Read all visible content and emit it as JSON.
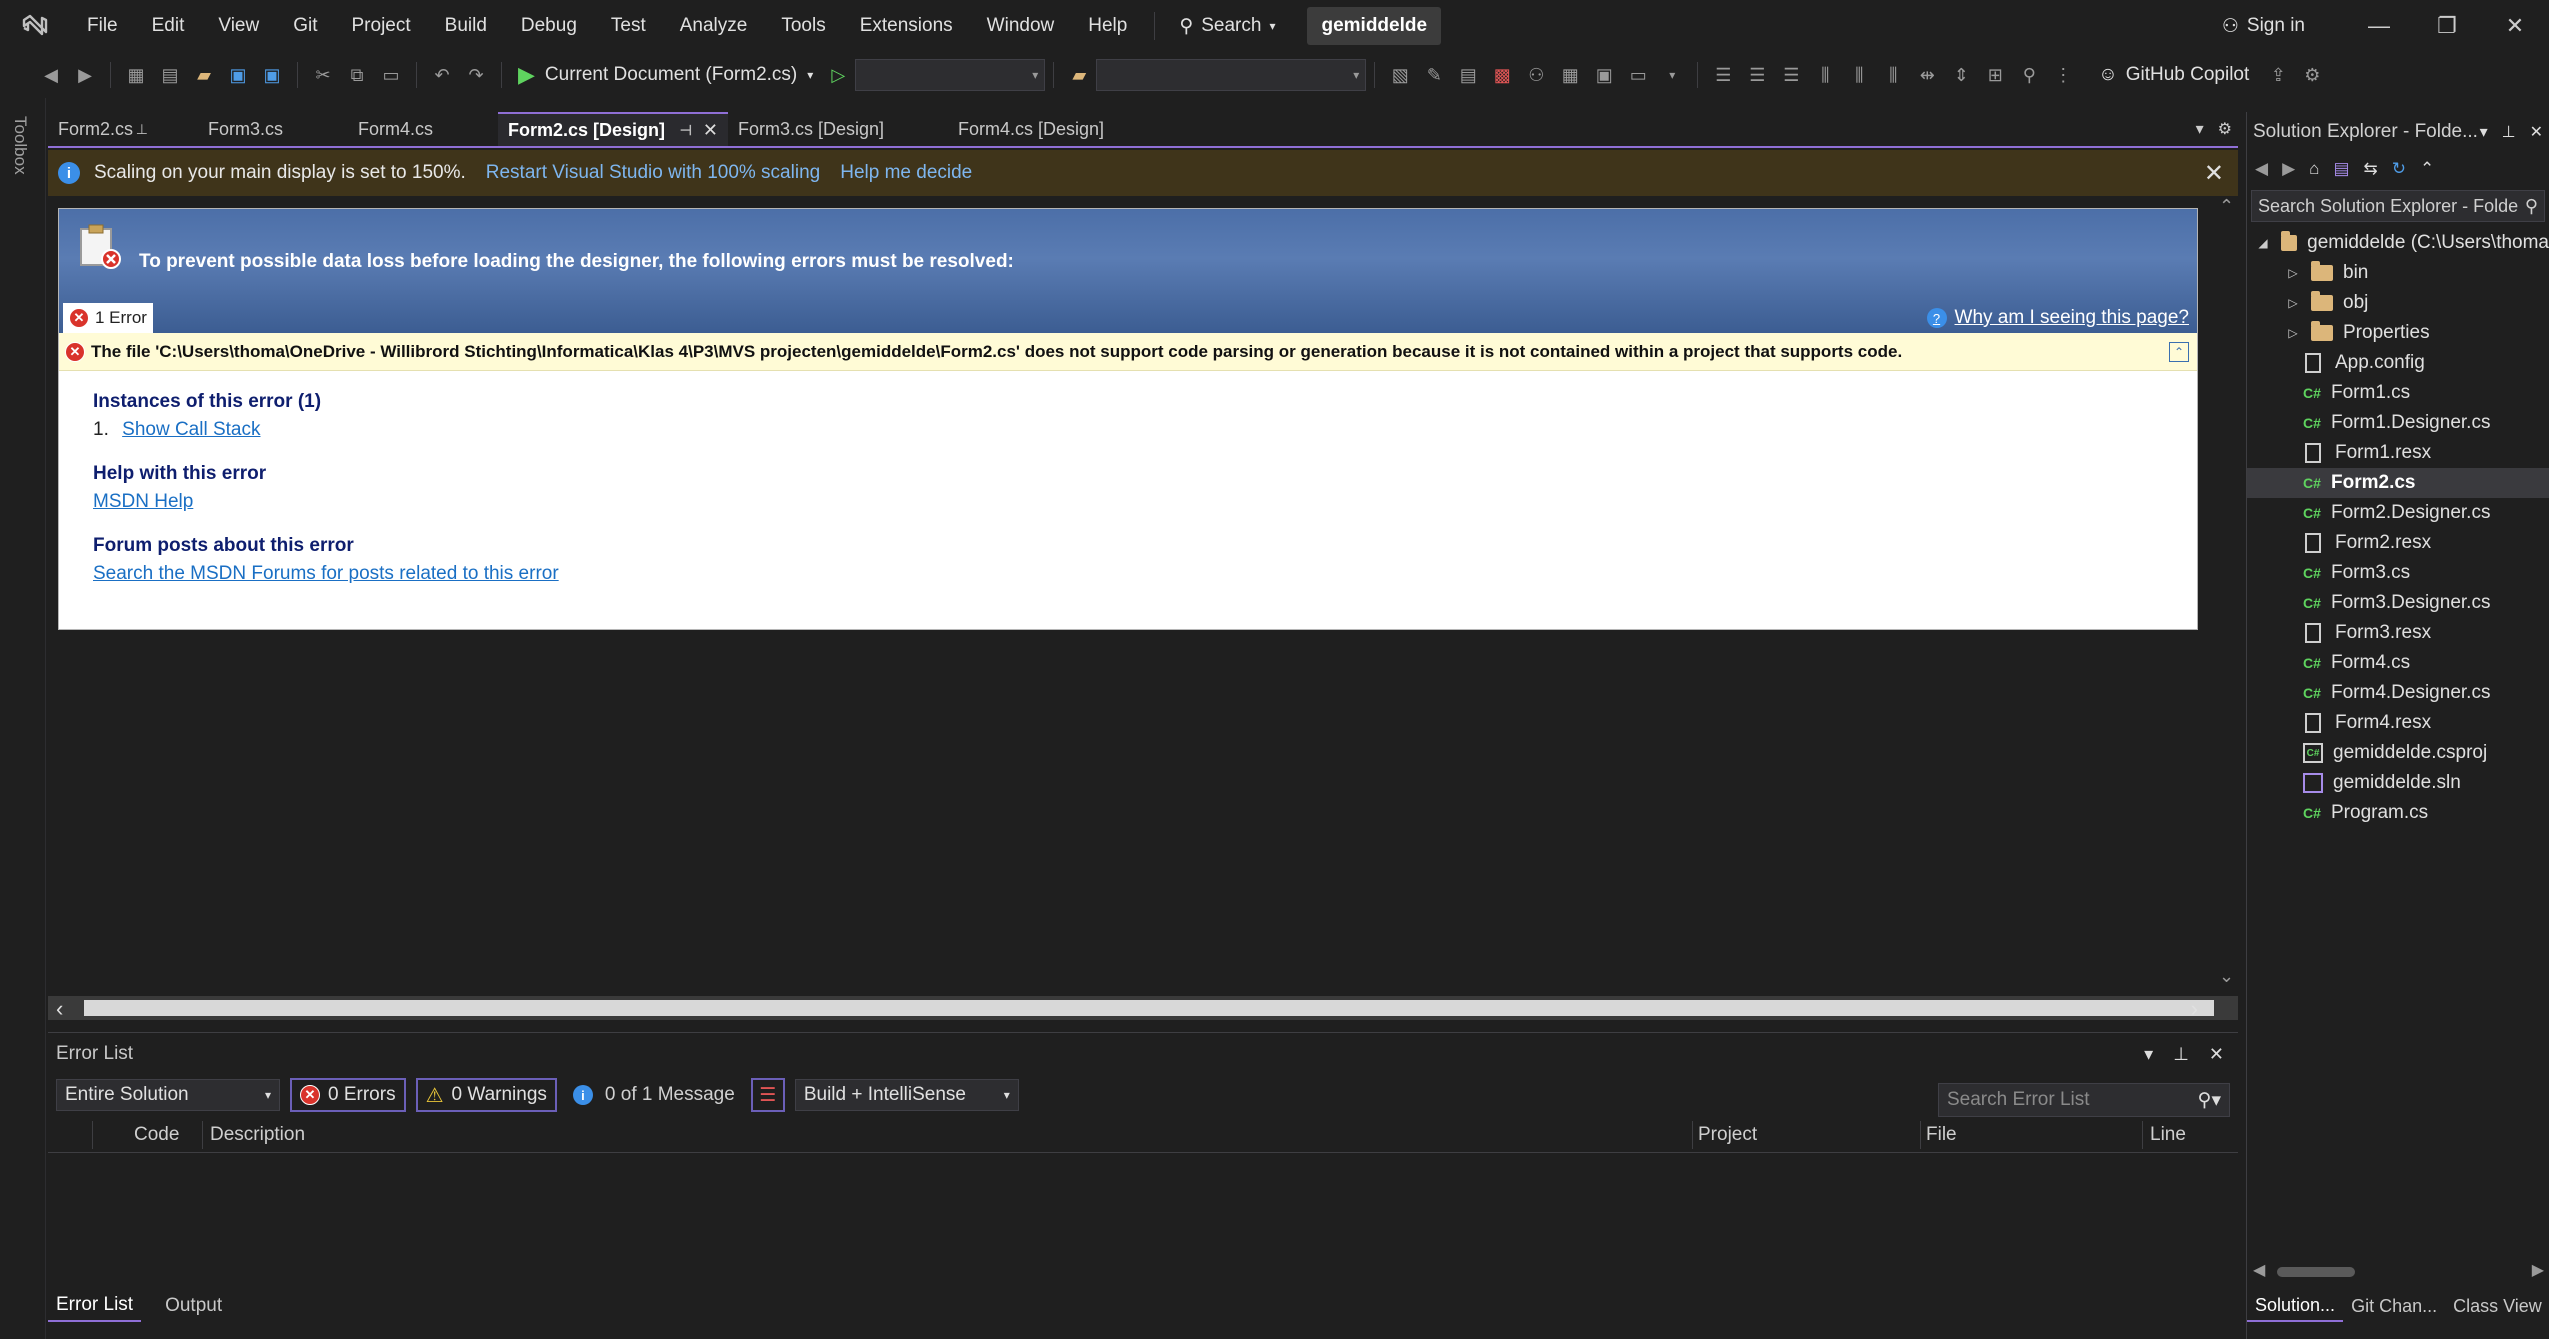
{
  "menu": {
    "items": [
      "File",
      "Edit",
      "View",
      "Git",
      "Project",
      "Build",
      "Debug",
      "Test",
      "Analyze",
      "Tools",
      "Extensions",
      "Window",
      "Help"
    ],
    "search_label": "Search",
    "solution_name": "gemiddelde",
    "sign_in": "Sign in"
  },
  "toolbar": {
    "run_label": "Current Document (Form2.cs)",
    "copilot_label": "GitHub Copilot"
  },
  "toolbox_label": "Toolbox",
  "tabs": [
    {
      "label": "Form2.cs"
    },
    {
      "label": "Form3.cs"
    },
    {
      "label": "Form4.cs"
    },
    {
      "label": "Form2.cs [Design]"
    },
    {
      "label": "Form3.cs [Design]"
    },
    {
      "label": "Form4.cs [Design]"
    }
  ],
  "infobar": {
    "message": "Scaling on your main display is set to 150%.",
    "restart_link": "Restart Visual Studio with 100% scaling",
    "help_link": "Help me decide"
  },
  "error_page": {
    "title": "To prevent possible data loss before loading the designer, the following errors must be resolved:",
    "error_count_tab": "1 Error",
    "why_link": "Why am I seeing this page?",
    "error_text": "The file 'C:\\Users\\thoma\\OneDrive - Willibrord Stichting\\Informatica\\Klas 4\\P3\\MVS projecten\\gemiddelde\\Form2.cs' does not support code parsing or generation because it is not contained within a project that supports code.",
    "instances_title": "Instances of this error (1)",
    "instance_number": "1.",
    "call_stack_link": "Show Call Stack",
    "help_title": "Help with this error",
    "msdn_link": "MSDN Help",
    "forum_title": "Forum posts about this error",
    "forum_link": "Search the MSDN Forums for posts related to this error"
  },
  "error_list": {
    "title": "Error List",
    "scope": "Entire Solution",
    "errors": "0 Errors",
    "warnings": "0 Warnings",
    "messages": "0 of 1 Message",
    "build_filter": "Build + IntelliSense",
    "search_placeholder": "Search Error List",
    "columns": {
      "code": "Code",
      "description": "Description",
      "project": "Project",
      "file": "File",
      "line": "Line"
    }
  },
  "bottom_tabs": [
    "Error List",
    "Output"
  ],
  "solution_explorer": {
    "title": "Solution Explorer - Folde...",
    "search_placeholder": "Search Solution Explorer - Folde",
    "root": "gemiddelde (C:\\Users\\thoma",
    "items": [
      {
        "label": "bin",
        "type": "folder"
      },
      {
        "label": "obj",
        "type": "folder"
      },
      {
        "label": "Properties",
        "type": "folder"
      },
      {
        "label": "App.config",
        "type": "config"
      },
      {
        "label": "Form1.cs",
        "type": "cs"
      },
      {
        "label": "Form1.Designer.cs",
        "type": "cs"
      },
      {
        "label": "Form1.resx",
        "type": "resx"
      },
      {
        "label": "Form2.cs",
        "type": "cs"
      },
      {
        "label": "Form2.Designer.cs",
        "type": "cs"
      },
      {
        "label": "Form2.resx",
        "type": "resx"
      },
      {
        "label": "Form3.cs",
        "type": "cs"
      },
      {
        "label": "Form3.Designer.cs",
        "type": "cs"
      },
      {
        "label": "Form3.resx",
        "type": "resx"
      },
      {
        "label": "Form4.cs",
        "type": "cs"
      },
      {
        "label": "Form4.Designer.cs",
        "type": "cs"
      },
      {
        "label": "Form4.resx",
        "type": "resx"
      },
      {
        "label": "gemiddelde.csproj",
        "type": "csproj"
      },
      {
        "label": "gemiddelde.sln",
        "type": "sln"
      },
      {
        "label": "Program.cs",
        "type": "cs"
      }
    ],
    "bottom_tabs": [
      "Solution...",
      "Git Chan...",
      "Class View"
    ]
  }
}
